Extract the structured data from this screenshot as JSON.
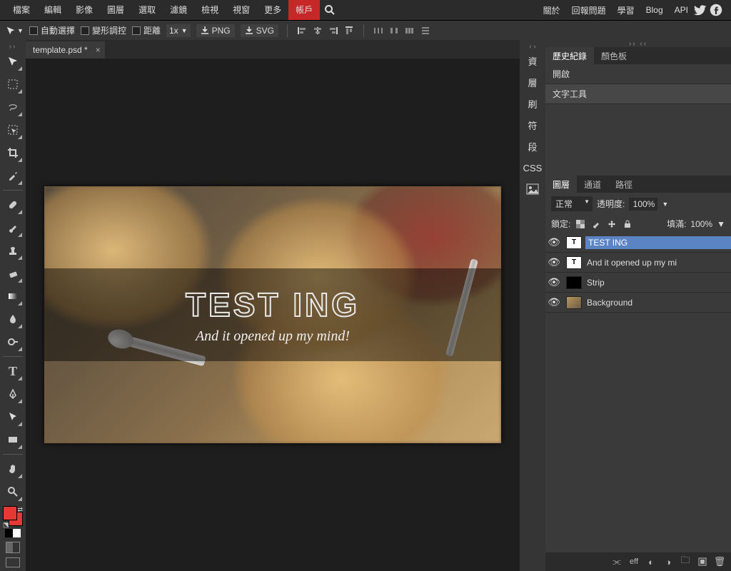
{
  "menu": {
    "items": [
      "檔案",
      "編輯",
      "影像",
      "圖層",
      "選取",
      "濾鏡",
      "檢視",
      "視窗",
      "更多"
    ],
    "account": "帳戶"
  },
  "toplinks": {
    "items": [
      "關於",
      "回報問題",
      "學習",
      "Blog",
      "API"
    ]
  },
  "optbar": {
    "auto_select": "自動選擇",
    "transform": "變形調控",
    "distance": "距離",
    "zoom": "1x",
    "png": "PNG",
    "svg": "SVG"
  },
  "doc": {
    "tab": "template.psd *",
    "title": "TEST ING",
    "subtitle": "And it opened up my mind!"
  },
  "dock": {
    "items": [
      "資",
      "層",
      "刷",
      "符",
      "段",
      "CSS"
    ]
  },
  "panels": {
    "history_tabs": {
      "history": "歷史紀錄",
      "swatches": "顏色板"
    },
    "history_items": [
      "開啟",
      "文字工具"
    ],
    "layer_tabs": {
      "layers": "圖層",
      "channels": "通道",
      "paths": "路徑"
    },
    "blend_mode": "正常",
    "opacity_label": "透明度:",
    "opacity": "100%",
    "lock_label": "鎖定:",
    "fill_label": "填滿:",
    "fill": "100%",
    "layers": [
      {
        "name": "TEST ING",
        "type": "text"
      },
      {
        "name": "And it opened up my mi",
        "type": "text"
      },
      {
        "name": "Strip",
        "type": "strip"
      },
      {
        "name": "Background",
        "type": "bg"
      }
    ]
  }
}
